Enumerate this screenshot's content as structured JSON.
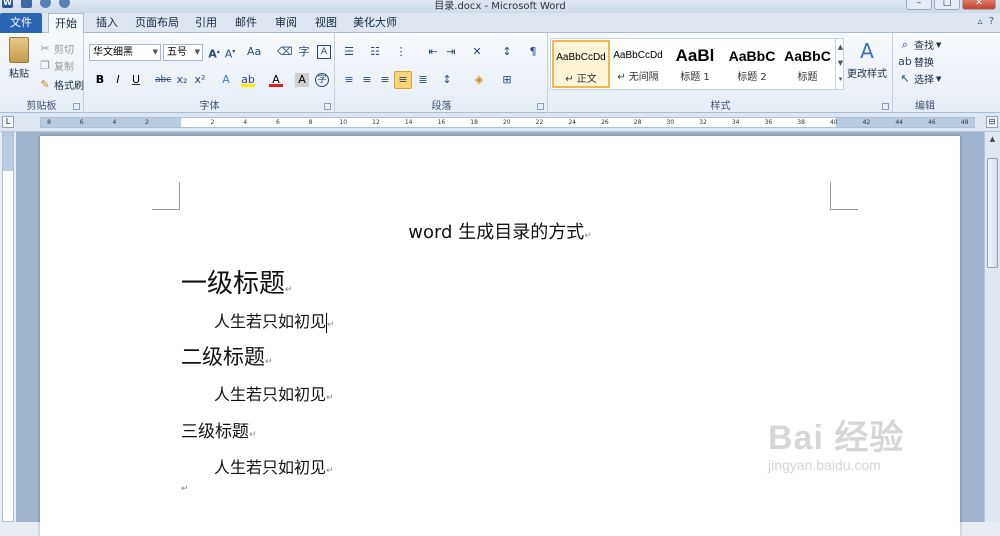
{
  "window": {
    "title": "目录.docx - Microsoft Word"
  },
  "tabs": [
    {
      "label": "文件",
      "id": "file"
    },
    {
      "label": "开始",
      "id": "home"
    },
    {
      "label": "插入",
      "id": "insert"
    },
    {
      "label": "页面布局",
      "id": "layout"
    },
    {
      "label": "引用",
      "id": "references"
    },
    {
      "label": "邮件",
      "id": "mailings"
    },
    {
      "label": "审阅",
      "id": "review"
    },
    {
      "label": "视图",
      "id": "view"
    },
    {
      "label": "美化大师",
      "id": "beautify"
    }
  ],
  "clipboard": {
    "paste": "粘贴",
    "cut": "剪切",
    "copy": "复制",
    "format_painter": "格式刷",
    "group": "剪贴板"
  },
  "font": {
    "name": "华文细黑",
    "size": "五号",
    "group": "字体"
  },
  "paragraph": {
    "group": "段落"
  },
  "styles": {
    "group": "样式",
    "items": [
      {
        "preview": "AaBbCcDd",
        "name": "↵ 正文"
      },
      {
        "preview": "AaBbCcDd",
        "name": "↵ 无间隔"
      },
      {
        "preview": "AaBl",
        "name": "标题 1"
      },
      {
        "preview": "AaBbC",
        "name": "标题 2"
      },
      {
        "preview": "AaBbC",
        "name": "标题"
      }
    ],
    "change": "更改样式"
  },
  "editing": {
    "find": "查找",
    "replace": "替换",
    "select": "选择",
    "group": "编辑"
  },
  "ruler": {
    "ticks": [
      "8",
      "6",
      "4",
      "2",
      "",
      "2",
      "4",
      "6",
      "8",
      "10",
      "12",
      "14",
      "16",
      "18",
      "20",
      "22",
      "24",
      "26",
      "28",
      "30",
      "32",
      "34",
      "36",
      "38",
      "40",
      "42",
      "44",
      "46",
      "48"
    ]
  },
  "document": {
    "title": "word 生成目录的方式",
    "h1": "一级标题",
    "p1": "人生若只如初见",
    "h2": "二级标题",
    "p2": "人生若只如初见",
    "h3": "三级标题",
    "p3": "人生若只如初见",
    "pilcrow": "↵"
  },
  "watermark": {
    "brand": "Bai 经验",
    "url": "jingyan.baidu.com"
  }
}
